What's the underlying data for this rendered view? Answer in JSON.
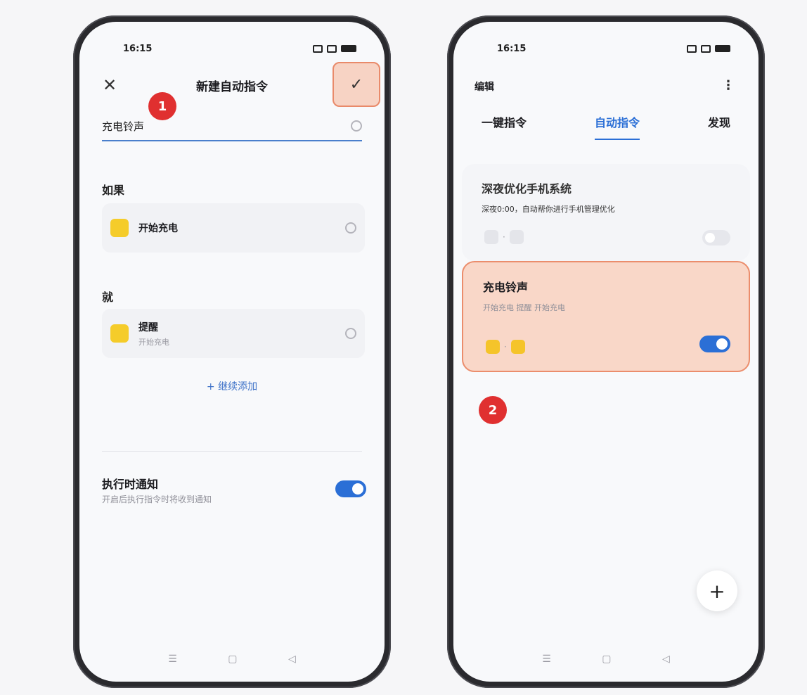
{
  "left": {
    "status_time": "16:15",
    "title": "新建自动指令",
    "badge": "1",
    "name_value": "充电铃声",
    "if_label": "如果",
    "if_task": {
      "title": "开始充电"
    },
    "then_label": "就",
    "then_task": {
      "title": "提醒",
      "subtitle": "开始充电"
    },
    "add_more": "+ 继续添加",
    "notify_title": "执行时通知",
    "notify_sub": "开启后执行指令时将收到通知",
    "notify_on": true
  },
  "right": {
    "status_time": "16:15",
    "edit_label": "编辑",
    "tabs": [
      {
        "label": "一键指令",
        "active": false
      },
      {
        "label": "自动指令",
        "active": true
      },
      {
        "label": "发现",
        "active": false
      }
    ],
    "routines": [
      {
        "title": "深夜优化手机系统",
        "subtitle": "深夜0:00，自动帮你进行手机管理优化",
        "enabled": false
      },
      {
        "title": "充电铃声",
        "subtitle": "开始充电 提醒 开始充电",
        "enabled": true
      }
    ],
    "badge": "2",
    "fab": "+"
  },
  "colors": {
    "accent": "#2b6fd6",
    "highlight": "#f9d7c8",
    "badge": "#e03030",
    "task_icon": "#f5cc2a"
  }
}
